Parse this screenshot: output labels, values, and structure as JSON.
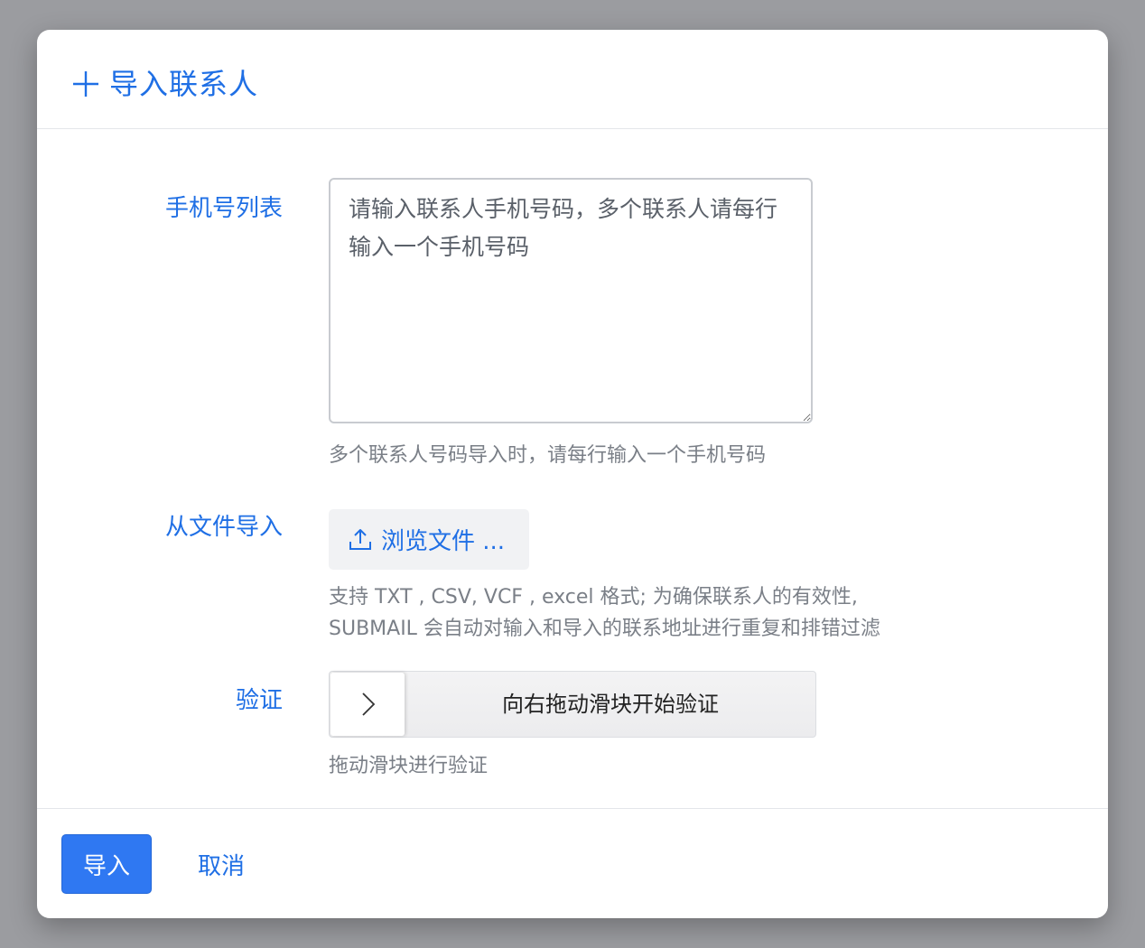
{
  "dialog": {
    "title": "导入联系人",
    "title_icon": "plus-icon"
  },
  "form": {
    "phone_list": {
      "label": "手机号列表",
      "value": "",
      "placeholder": "请输入联系人手机号码，多个联系人请每行输入一个手机号码",
      "help": "多个联系人号码导入时，请每行输入一个手机号码"
    },
    "file_import": {
      "label": "从文件导入",
      "button_label": "浏览文件 ...",
      "button_icon": "upload-icon",
      "help_line1": "支持 TXT , CSV, VCF , excel 格式; 为确保联系人的有效性,",
      "help_line2": "SUBMAIL 会自动对输入和导入的联系地址进行重复和排错过滤"
    },
    "verify": {
      "label": "验证",
      "slider_text": "向右拖动滑块开始验证",
      "handle_icon": "chevron-right-icon",
      "help": "拖动滑块进行验证"
    }
  },
  "footer": {
    "import_label": "导入",
    "cancel_label": "取消"
  },
  "colors": {
    "accent": "#1f6fe5",
    "primary_button": "#2f78f2",
    "backdrop": "#9b9ca0"
  }
}
